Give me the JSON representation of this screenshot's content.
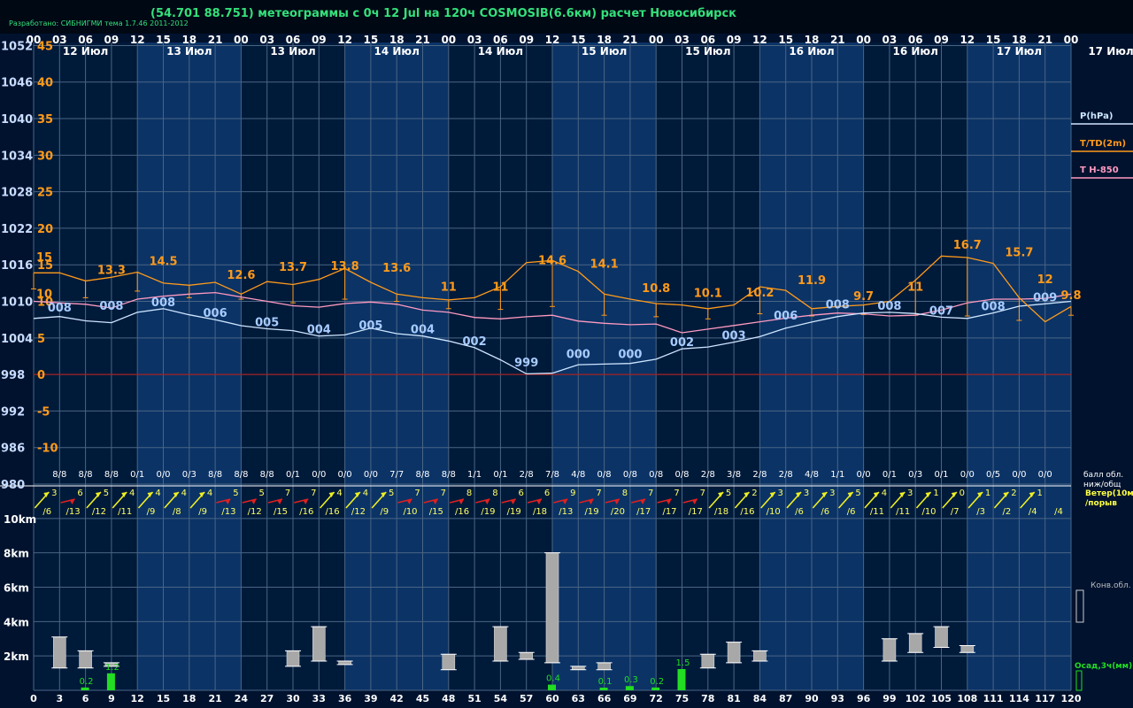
{
  "header": {
    "title": "(54.701 88.751) метеограммы с  0ч 12 Jul на 120ч COSMOSIB(6.6км) расчет Новосибирск",
    "credit": "Разработано: СИБНИГМИ тема 1.7.46 2011-2012"
  },
  "colors": {
    "background": "#00122e",
    "band_dark": "#001a3a",
    "band_light": "#0b3366",
    "grid": "#4a6584",
    "pressure": "#cfe6ff",
    "temperature": "#ff9a1a",
    "t850": "#ff9ac0",
    "zero_line": "#a02020",
    "precip": "#22dd22",
    "cloud": "#a8a8a8",
    "wind_yellow": "#f0f020",
    "wind_red": "#e02020"
  },
  "chart_data": [
    {
      "type": "line",
      "name": "meteogram",
      "top_hours": [
        "00",
        "03",
        "06",
        "09",
        "12",
        "15",
        "18",
        "21",
        "00",
        "03",
        "06",
        "09",
        "12",
        "15",
        "18",
        "21",
        "00",
        "03",
        "06",
        "09",
        "12",
        "15",
        "18",
        "21",
        "00",
        "03",
        "06",
        "09",
        "12",
        "15",
        "18",
        "21",
        "00",
        "03",
        "06",
        "09",
        "12",
        "15",
        "18",
        "21",
        "00"
      ],
      "date_labels": [
        "12 Июл",
        "13 Июл",
        "13 Июл",
        "14 Июл",
        "14 Июл",
        "15 Июл",
        "15 Июл",
        "16 Июл",
        "16 Июл",
        "17 Июл"
      ],
      "right_date": "17 Июл",
      "pressure_ticks": [
        "1052",
        "1046",
        "1040",
        "1034",
        "1028",
        "1022",
        "1016",
        "1010",
        "1004",
        "998",
        "992",
        "986",
        "980"
      ],
      "temp_ticks": [
        "45",
        "40",
        "35",
        "30",
        "25",
        "20",
        "15",
        "10",
        "5",
        "0",
        "-5",
        "-10"
      ],
      "legend": [
        "P(hPa)",
        "T/TD(2m)",
        "T H-850"
      ],
      "x_hours": [
        0,
        3,
        6,
        9,
        12,
        15,
        18,
        21,
        24,
        27,
        30,
        33,
        36,
        39,
        42,
        45,
        48,
        51,
        54,
        57,
        60,
        63,
        66,
        69,
        72,
        75,
        78,
        81,
        84,
        87,
        90,
        93,
        96,
        99,
        102,
        105,
        108,
        111,
        114,
        117,
        120
      ],
      "pressure": [
        1007.2,
        1007.5,
        1006.8,
        1006.5,
        1008.2,
        1008.8,
        1007.8,
        1007.0,
        1006.0,
        1005.5,
        1005.2,
        1004.3,
        1004.5,
        1005.6,
        1004.7,
        1004.3,
        1003.5,
        1002.4,
        1000.4,
        998.1,
        998.2,
        999.6,
        999.7,
        999.8,
        1000.5,
        1002.2,
        1002.5,
        1003.3,
        1004.2,
        1005.6,
        1006.6,
        1007.5,
        1008.1,
        1008.2,
        1008.0,
        1007.4,
        1007.2,
        1008.1,
        1009.2,
        1009.6,
        1010.0
      ],
      "pressure_labels": [
        {
          "h": 3,
          "v": 1007.9,
          "t": "008"
        },
        {
          "h": 9,
          "v": 1008.2,
          "t": "008"
        },
        {
          "h": 15,
          "v": 1008.8,
          "t": "008"
        },
        {
          "h": 21,
          "v": 1007.0,
          "t": "006"
        },
        {
          "h": 27,
          "v": 1005.5,
          "t": "005"
        },
        {
          "h": 33,
          "v": 1004.3,
          "t": "004"
        },
        {
          "h": 39,
          "v": 1005.0,
          "t": "005"
        },
        {
          "h": 45,
          "v": 1004.3,
          "t": "004"
        },
        {
          "h": 51,
          "v": 1002.4,
          "t": "002"
        },
        {
          "h": 57,
          "v": 998.9,
          "t": "999"
        },
        {
          "h": 63,
          "v": 1000.3,
          "t": "000"
        },
        {
          "h": 69,
          "v": 1000.3,
          "t": "000"
        },
        {
          "h": 75,
          "v": 1002.2,
          "t": "002"
        },
        {
          "h": 81,
          "v": 1003.3,
          "t": "003"
        },
        {
          "h": 87,
          "v": 1006.6,
          "t": "006"
        },
        {
          "h": 93,
          "v": 1008.4,
          "t": "008"
        },
        {
          "h": 99,
          "v": 1008.2,
          "t": "008"
        },
        {
          "h": 105,
          "v": 1007.4,
          "t": "007"
        },
        {
          "h": 111,
          "v": 1008.1,
          "t": "008"
        },
        {
          "h": 117,
          "v": 1009.6,
          "t": "009"
        }
      ],
      "temperature": [
        13.9,
        13.9,
        12.8,
        13.3,
        14.0,
        12.5,
        12.2,
        12.6,
        11.0,
        12.7,
        12.3,
        13.0,
        14.5,
        12.6,
        11.0,
        10.5,
        10.2,
        10.5,
        12.0,
        15.3,
        15.6,
        14.1,
        11.0,
        10.3,
        9.7,
        9.5,
        9.0,
        9.5,
        12.0,
        11.5,
        9.0,
        9.3,
        9.5,
        10.0,
        12.9,
        16.2,
        16.0,
        15.2,
        10.5,
        7.2,
        9.3
      ],
      "dewpoint": [
        11.7,
        11.7,
        10.5,
        10.9,
        11.4,
        10.5,
        10.5,
        10.5,
        10.3,
        10.2,
        9.8,
        9.8,
        10.3,
        10.4,
        10.0,
        9.5,
        9.0,
        8.6,
        8.9,
        9.4,
        9.3,
        8.7,
        8.1,
        8.2,
        7.9,
        7.6,
        7.6,
        7.9,
        8.3,
        8.0,
        8.0,
        8.0,
        8.2,
        8.1,
        8.1,
        7.9,
        8.0,
        8.3,
        7.4,
        6.1,
        8.1
      ],
      "temp_labels": [
        {
          "h": 0,
          "v": 15,
          "t": "15"
        },
        {
          "h": 0,
          "v": 10,
          "t": "10"
        },
        {
          "h": 9,
          "v": 13.3,
          "t": "13.3"
        },
        {
          "h": 15,
          "v": 14.5,
          "t": "14.5"
        },
        {
          "h": 24,
          "v": 12.6,
          "t": "12.6"
        },
        {
          "h": 30,
          "v": 13.7,
          "t": "13.7"
        },
        {
          "h": 36,
          "v": 13.8,
          "t": "13.8"
        },
        {
          "h": 42,
          "v": 13.6,
          "t": "13.6"
        },
        {
          "h": 48,
          "v": 11,
          "t": "11"
        },
        {
          "h": 54,
          "v": 11,
          "t": "11"
        },
        {
          "h": 60,
          "v": 14.6,
          "t": "14.6"
        },
        {
          "h": 66,
          "v": 14.1,
          "t": "14.1"
        },
        {
          "h": 72,
          "v": 10.8,
          "t": "10.8"
        },
        {
          "h": 78,
          "v": 10.1,
          "t": "10.1"
        },
        {
          "h": 84,
          "v": 10.2,
          "t": "10.2"
        },
        {
          "h": 90,
          "v": 11.9,
          "t": "11.9"
        },
        {
          "h": 96,
          "v": 9.7,
          "t": "9.7"
        },
        {
          "h": 102,
          "v": 11,
          "t": "11"
        },
        {
          "h": 108,
          "v": 16.7,
          "t": "16.7"
        },
        {
          "h": 114,
          "v": 15.7,
          "t": "15.7"
        },
        {
          "h": 117,
          "v": 12,
          "t": "12"
        },
        {
          "h": 120,
          "v": 9.8,
          "t": "9.8"
        }
      ],
      "t850": [
        10.0,
        9.8,
        9.6,
        9.1,
        10.3,
        10.7,
        11.0,
        11.2,
        10.6,
        10.0,
        9.4,
        9.2,
        9.7,
        9.9,
        9.6,
        8.8,
        8.5,
        7.8,
        7.6,
        7.9,
        8.1,
        7.3,
        7.0,
        6.8,
        6.9,
        5.7,
        6.2,
        6.7,
        7.2,
        7.7,
        8.1,
        8.4,
        8.3,
        8.0,
        8.1,
        8.8,
        9.8,
        10.3,
        10.3,
        10.4,
        11.0
      ],
      "cloud_fractions": [
        "8/8",
        "8/8",
        "8/8",
        "0/1",
        "0/0",
        "0/3",
        "8/8",
        "8/8",
        "8/8",
        "0/1",
        "0/0",
        "0/0",
        "0/0",
        "7/7",
        "8/8",
        "8/8",
        "1/1",
        "0/1",
        "2/8",
        "7/8",
        "4/8",
        "0/8",
        "0/8",
        "0/8",
        "0/8",
        "2/8",
        "3/8",
        "2/8",
        "2/8",
        "4/8",
        "1/1",
        "0/0",
        "0/1",
        "0/3",
        "0/1",
        "0/0",
        "0/5",
        "0/0",
        "0/0"
      ],
      "cloud_legend": [
        "балл обл.",
        "ниж/общ"
      ],
      "y_range_pressure": [
        980,
        1052
      ],
      "y_range_temp": [
        -10,
        45
      ]
    },
    {
      "type": "table",
      "name": "wind",
      "legend": [
        "Ветер(10м)",
        "/порыв"
      ],
      "speed": [
        "3",
        "6",
        "5",
        "4",
        "4",
        "4",
        "4",
        "5",
        "5",
        "7",
        "7",
        "4",
        "4",
        "5",
        "7",
        "7",
        "8",
        "8",
        "6",
        "6",
        "9",
        "7",
        "8",
        "7",
        "7",
        "7",
        "5",
        "2",
        "3",
        "3",
        "3",
        "5",
        "4",
        "3",
        "1",
        "0",
        "1",
        "2",
        "1"
      ],
      "gust": [
        "/6",
        "/13",
        "/12",
        "/11",
        "/9",
        "/8",
        "/9",
        "/13",
        "/12",
        "/15",
        "/16",
        "/16",
        "/12",
        "/9",
        "/10",
        "/15",
        "/16",
        "/19",
        "/19",
        "/18",
        "/13",
        "/19",
        "/20",
        "/17",
        "/17",
        "/17",
        "/18",
        "/16",
        "/10",
        "/6",
        "/6",
        "/6",
        "/11",
        "/11",
        "/10",
        "/7",
        "/3",
        "/2",
        "/4",
        "/4"
      ],
      "strong": [
        false,
        true,
        false,
        false,
        false,
        false,
        false,
        true,
        true,
        true,
        true,
        false,
        false,
        false,
        true,
        true,
        true,
        true,
        true,
        true,
        true,
        true,
        true,
        true,
        true,
        true,
        false,
        false,
        false,
        false,
        false,
        false,
        false,
        false,
        false,
        false,
        false,
        false,
        false
      ]
    },
    {
      "type": "bar",
      "name": "clouds-and-precip",
      "x_hours": [
        0,
        3,
        6,
        9,
        12,
        15,
        18,
        21,
        24,
        27,
        30,
        33,
        36,
        39,
        42,
        45,
        48,
        51,
        54,
        57,
        60,
        63,
        66,
        69,
        72,
        75,
        78,
        81,
        84,
        87,
        90,
        93,
        96,
        99,
        102,
        105,
        108,
        111,
        114,
        117,
        120
      ],
      "x_ticks": [
        "0",
        "3",
        "6",
        "9",
        "12",
        "15",
        "18",
        "21",
        "24",
        "27",
        "30",
        "33",
        "36",
        "39",
        "42",
        "45",
        "48",
        "51",
        "54",
        "57",
        "60",
        "63",
        "66",
        "69",
        "72",
        "75",
        "78",
        "81",
        "84",
        "87",
        "90",
        "93",
        "96",
        "99",
        "102",
        "105",
        "108",
        "111",
        "114",
        "117",
        "120"
      ],
      "y_ticks": [
        "10km",
        "8km",
        "6km",
        "4km",
        "2km"
      ],
      "y_range_km": [
        0,
        10.7
      ],
      "conv_clouds": [
        {
          "h": 3,
          "base": 1.3,
          "top": 3.1
        },
        {
          "h": 6,
          "base": 1.3,
          "top": 2.3
        },
        {
          "h": 9,
          "base": 1.4,
          "top": 1.6
        },
        {
          "h": 30,
          "base": 1.4,
          "top": 2.3
        },
        {
          "h": 33,
          "base": 1.7,
          "top": 3.7
        },
        {
          "h": 36,
          "base": 1.5,
          "top": 1.7
        },
        {
          "h": 48,
          "base": 1.2,
          "top": 2.1
        },
        {
          "h": 54,
          "base": 1.7,
          "top": 3.7
        },
        {
          "h": 57,
          "base": 1.8,
          "top": 2.2
        },
        {
          "h": 60,
          "base": 1.6,
          "top": 8.0
        },
        {
          "h": 63,
          "base": 1.2,
          "top": 1.4
        },
        {
          "h": 66,
          "base": 1.2,
          "top": 1.6
        },
        {
          "h": 78,
          "base": 1.3,
          "top": 2.1
        },
        {
          "h": 81,
          "base": 1.6,
          "top": 2.8
        },
        {
          "h": 84,
          "base": 1.7,
          "top": 2.3
        },
        {
          "h": 99,
          "base": 1.7,
          "top": 3.0
        },
        {
          "h": 102,
          "base": 2.2,
          "top": 3.3
        },
        {
          "h": 105,
          "base": 2.5,
          "top": 3.7
        },
        {
          "h": 108,
          "base": 2.2,
          "top": 2.6
        }
      ],
      "precip": [
        {
          "h": 6,
          "v": 0.2,
          "t": "0.2"
        },
        {
          "h": 9,
          "v": 1.2,
          "t": "1.2"
        },
        {
          "h": 60,
          "v": 0.4,
          "t": "0.4"
        },
        {
          "h": 66,
          "v": 0.1,
          "t": "0.1"
        },
        {
          "h": 69,
          "v": 0.3,
          "t": "0.3"
        },
        {
          "h": 72,
          "v": 0.2,
          "t": "0.2"
        },
        {
          "h": 75,
          "v": 1.5,
          "t": "1.5"
        }
      ],
      "legend": [
        "Конв.обл.",
        "Осад,3ч(мм)"
      ]
    }
  ]
}
